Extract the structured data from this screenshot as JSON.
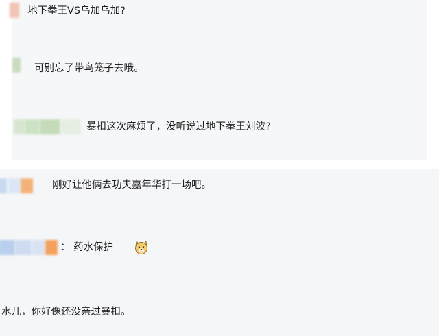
{
  "comments": [
    {
      "text": "地下拳王VS乌加乌加?"
    },
    {
      "text": "可别忘了带鸟笼子去哦。"
    },
    {
      "text": "暴扣这次麻烦了，没听说过地下拳王刘波?"
    },
    {
      "text": "刚好让他俩去功夫嘉年华打一场吧。"
    },
    {
      "text": "：  药水保护"
    },
    {
      "text": "水儿，你好像还没亲过暴扣。"
    }
  ],
  "icons": {
    "reaction_emoji": "doge-face-icon"
  },
  "colors": {
    "panel_background": "#f6f7f9",
    "divider": "#e2e4e8",
    "text": "#222222"
  }
}
